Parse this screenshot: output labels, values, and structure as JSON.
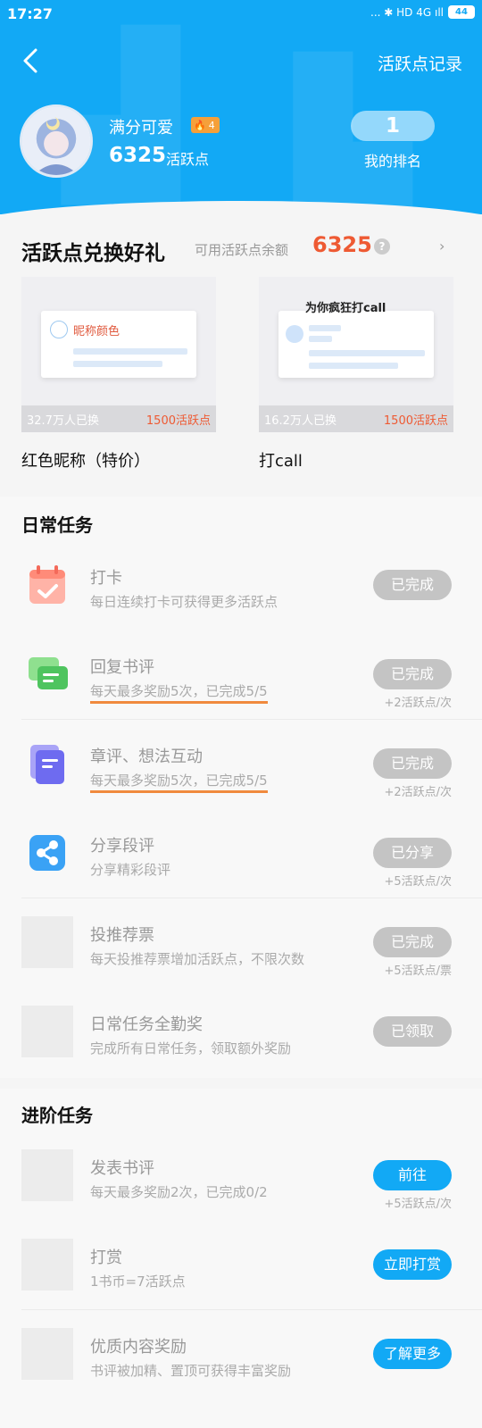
{
  "status_bar": {
    "time": "17:27",
    "icons": "... ✱ HD 4G ıll",
    "battery": "44"
  },
  "header": {
    "record_label": "活跃点记录",
    "username": "满分可爱",
    "level": "4",
    "points": "6325",
    "points_unit": "活跃点",
    "rank": "1",
    "rank_label": "我的排名"
  },
  "exchange": {
    "title": "活跃点兑换好礼",
    "balance_label": "可用活跃点余额",
    "balance": "6325",
    "help": "?",
    "chevron": "›",
    "gifts": [
      {
        "name": "红色昵称（特价）",
        "preview_text": "昵称颜色",
        "count": "32.7万人已换",
        "price": "1500活跃点"
      },
      {
        "name": "打call",
        "preview_text": "为你疯狂打call",
        "count": "16.2万人已换",
        "price": "1500活跃点"
      }
    ]
  },
  "daily": {
    "title": "日常任务",
    "tasks": [
      {
        "title": "打卡",
        "desc": "每日连续打卡可获得更多活跃点",
        "button": "已完成",
        "reward": ""
      },
      {
        "title": "回复书评",
        "desc": "每天最多奖励5次，已完成5/5",
        "button": "已完成",
        "reward": "+2活跃点/次"
      },
      {
        "title": "章评、想法互动",
        "desc": "每天最多奖励5次，已完成5/5",
        "button": "已完成",
        "reward": "+2活跃点/次"
      },
      {
        "title": "分享段评",
        "desc": "分享精彩段评",
        "button": "已分享",
        "reward": "+5活跃点/次"
      },
      {
        "title": "投推荐票",
        "desc": "每天投推荐票增加活跃点，不限次数",
        "button": "已完成",
        "reward": "+5活跃点/票"
      },
      {
        "title": "日常任务全勤奖",
        "desc": "完成所有日常任务，领取额外奖励",
        "button": "已领取",
        "reward": ""
      }
    ]
  },
  "advanced": {
    "title": "进阶任务",
    "tasks": [
      {
        "title": "发表书评",
        "desc": "每天最多奖励2次，已完成0/2",
        "button": "前往",
        "reward": "+5活跃点/次"
      },
      {
        "title": "打赏",
        "desc": "1书币=7活跃点",
        "button": "立即打赏",
        "reward": ""
      },
      {
        "title": "优质内容奖励",
        "desc": "书评被加精、置顶可获得丰富奖励",
        "button": "了解更多",
        "reward": ""
      }
    ]
  },
  "colors": {
    "accent": "#12a9f5",
    "highlight": "#ee5a33",
    "done_button": "#c4c4c4"
  }
}
